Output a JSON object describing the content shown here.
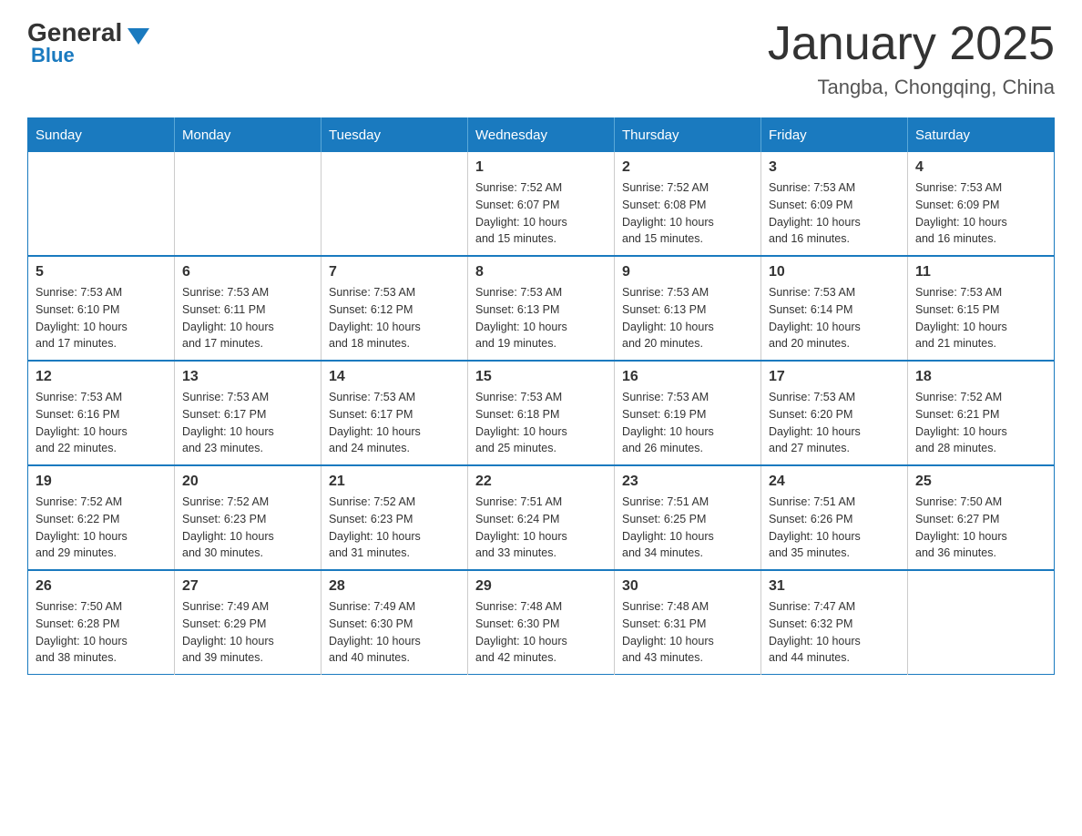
{
  "header": {
    "logo_general": "General",
    "logo_blue": "Blue",
    "main_title": "January 2025",
    "subtitle": "Tangba, Chongqing, China"
  },
  "calendar": {
    "days_of_week": [
      "Sunday",
      "Monday",
      "Tuesday",
      "Wednesday",
      "Thursday",
      "Friday",
      "Saturday"
    ],
    "weeks": [
      [
        {
          "day": "",
          "info": ""
        },
        {
          "day": "",
          "info": ""
        },
        {
          "day": "",
          "info": ""
        },
        {
          "day": "1",
          "info": "Sunrise: 7:52 AM\nSunset: 6:07 PM\nDaylight: 10 hours\nand 15 minutes."
        },
        {
          "day": "2",
          "info": "Sunrise: 7:52 AM\nSunset: 6:08 PM\nDaylight: 10 hours\nand 15 minutes."
        },
        {
          "day": "3",
          "info": "Sunrise: 7:53 AM\nSunset: 6:09 PM\nDaylight: 10 hours\nand 16 minutes."
        },
        {
          "day": "4",
          "info": "Sunrise: 7:53 AM\nSunset: 6:09 PM\nDaylight: 10 hours\nand 16 minutes."
        }
      ],
      [
        {
          "day": "5",
          "info": "Sunrise: 7:53 AM\nSunset: 6:10 PM\nDaylight: 10 hours\nand 17 minutes."
        },
        {
          "day": "6",
          "info": "Sunrise: 7:53 AM\nSunset: 6:11 PM\nDaylight: 10 hours\nand 17 minutes."
        },
        {
          "day": "7",
          "info": "Sunrise: 7:53 AM\nSunset: 6:12 PM\nDaylight: 10 hours\nand 18 minutes."
        },
        {
          "day": "8",
          "info": "Sunrise: 7:53 AM\nSunset: 6:13 PM\nDaylight: 10 hours\nand 19 minutes."
        },
        {
          "day": "9",
          "info": "Sunrise: 7:53 AM\nSunset: 6:13 PM\nDaylight: 10 hours\nand 20 minutes."
        },
        {
          "day": "10",
          "info": "Sunrise: 7:53 AM\nSunset: 6:14 PM\nDaylight: 10 hours\nand 20 minutes."
        },
        {
          "day": "11",
          "info": "Sunrise: 7:53 AM\nSunset: 6:15 PM\nDaylight: 10 hours\nand 21 minutes."
        }
      ],
      [
        {
          "day": "12",
          "info": "Sunrise: 7:53 AM\nSunset: 6:16 PM\nDaylight: 10 hours\nand 22 minutes."
        },
        {
          "day": "13",
          "info": "Sunrise: 7:53 AM\nSunset: 6:17 PM\nDaylight: 10 hours\nand 23 minutes."
        },
        {
          "day": "14",
          "info": "Sunrise: 7:53 AM\nSunset: 6:17 PM\nDaylight: 10 hours\nand 24 minutes."
        },
        {
          "day": "15",
          "info": "Sunrise: 7:53 AM\nSunset: 6:18 PM\nDaylight: 10 hours\nand 25 minutes."
        },
        {
          "day": "16",
          "info": "Sunrise: 7:53 AM\nSunset: 6:19 PM\nDaylight: 10 hours\nand 26 minutes."
        },
        {
          "day": "17",
          "info": "Sunrise: 7:53 AM\nSunset: 6:20 PM\nDaylight: 10 hours\nand 27 minutes."
        },
        {
          "day": "18",
          "info": "Sunrise: 7:52 AM\nSunset: 6:21 PM\nDaylight: 10 hours\nand 28 minutes."
        }
      ],
      [
        {
          "day": "19",
          "info": "Sunrise: 7:52 AM\nSunset: 6:22 PM\nDaylight: 10 hours\nand 29 minutes."
        },
        {
          "day": "20",
          "info": "Sunrise: 7:52 AM\nSunset: 6:23 PM\nDaylight: 10 hours\nand 30 minutes."
        },
        {
          "day": "21",
          "info": "Sunrise: 7:52 AM\nSunset: 6:23 PM\nDaylight: 10 hours\nand 31 minutes."
        },
        {
          "day": "22",
          "info": "Sunrise: 7:51 AM\nSunset: 6:24 PM\nDaylight: 10 hours\nand 33 minutes."
        },
        {
          "day": "23",
          "info": "Sunrise: 7:51 AM\nSunset: 6:25 PM\nDaylight: 10 hours\nand 34 minutes."
        },
        {
          "day": "24",
          "info": "Sunrise: 7:51 AM\nSunset: 6:26 PM\nDaylight: 10 hours\nand 35 minutes."
        },
        {
          "day": "25",
          "info": "Sunrise: 7:50 AM\nSunset: 6:27 PM\nDaylight: 10 hours\nand 36 minutes."
        }
      ],
      [
        {
          "day": "26",
          "info": "Sunrise: 7:50 AM\nSunset: 6:28 PM\nDaylight: 10 hours\nand 38 minutes."
        },
        {
          "day": "27",
          "info": "Sunrise: 7:49 AM\nSunset: 6:29 PM\nDaylight: 10 hours\nand 39 minutes."
        },
        {
          "day": "28",
          "info": "Sunrise: 7:49 AM\nSunset: 6:30 PM\nDaylight: 10 hours\nand 40 minutes."
        },
        {
          "day": "29",
          "info": "Sunrise: 7:48 AM\nSunset: 6:30 PM\nDaylight: 10 hours\nand 42 minutes."
        },
        {
          "day": "30",
          "info": "Sunrise: 7:48 AM\nSunset: 6:31 PM\nDaylight: 10 hours\nand 43 minutes."
        },
        {
          "day": "31",
          "info": "Sunrise: 7:47 AM\nSunset: 6:32 PM\nDaylight: 10 hours\nand 44 minutes."
        },
        {
          "day": "",
          "info": ""
        }
      ]
    ]
  }
}
